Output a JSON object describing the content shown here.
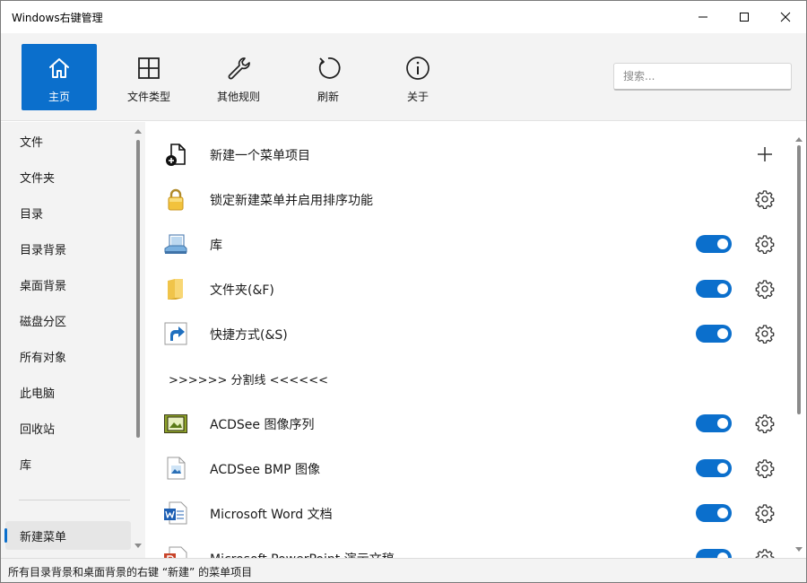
{
  "window": {
    "title": "Windows右键管理"
  },
  "toolbar": {
    "items": [
      {
        "label": "主页",
        "icon": "home-icon",
        "active": true
      },
      {
        "label": "文件类型",
        "icon": "grid-icon"
      },
      {
        "label": "其他规则",
        "icon": "wrench-icon"
      },
      {
        "label": "刷新",
        "icon": "refresh-icon"
      },
      {
        "label": "关于",
        "icon": "info-icon"
      }
    ],
    "search": {
      "placeholder": "搜索..."
    }
  },
  "sidebar": {
    "items": [
      {
        "label": "文件"
      },
      {
        "label": "文件夹"
      },
      {
        "label": "目录"
      },
      {
        "label": "目录背景"
      },
      {
        "label": "桌面背景"
      },
      {
        "label": "磁盘分区"
      },
      {
        "label": "所有对象"
      },
      {
        "label": "此电脑"
      },
      {
        "label": "回收站"
      },
      {
        "label": "库"
      },
      {
        "label": "新建菜单",
        "selected": true
      }
    ]
  },
  "main": {
    "rows": [
      {
        "label": "新建一个菜单项目",
        "icon": "new-file-icon",
        "action": "plus-icon"
      },
      {
        "label": "锁定新建菜单并启用排序功能",
        "icon": "lock-icon",
        "action": "gear-icon"
      },
      {
        "label": "库",
        "icon": "library-icon",
        "toggle": true
      },
      {
        "label": "文件夹(&F)",
        "icon": "folder-icon",
        "toggle": true
      },
      {
        "label": "快捷方式(&S)",
        "icon": "shortcut-icon",
        "toggle": true
      },
      {
        "label": ">>>>>> 分割线 <<<<<<",
        "separator": true
      },
      {
        "label": "ACDSee 图像序列",
        "icon": "acdsee-sequence-icon",
        "toggle": true
      },
      {
        "label": "ACDSee BMP 图像",
        "icon": "bmp-image-icon",
        "toggle": true
      },
      {
        "label": "Microsoft Word 文档",
        "icon": "word-icon",
        "toggle": true
      },
      {
        "label": "Microsoft PowerPoint 演示文稿",
        "icon": "powerpoint-icon",
        "toggle": true
      }
    ]
  },
  "statusbar": {
    "text": "所有目录背景和桌面背景的右键 “新建” 的菜单项目"
  },
  "colors": {
    "accent": "#0b6fcc",
    "toolbar_bg": "#f3f3f3"
  }
}
